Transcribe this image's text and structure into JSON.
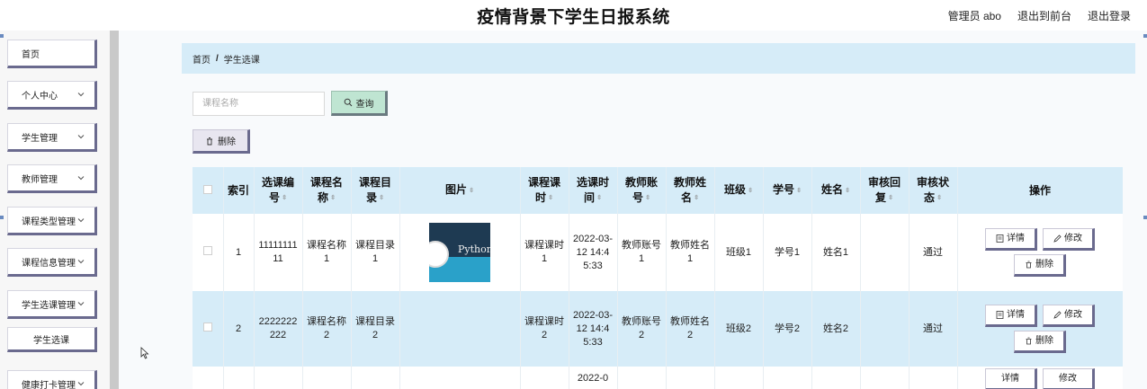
{
  "header": {
    "title": "疫情背景下学生日报系统",
    "admin_label": "管理员 abo",
    "exit_front_label": "退出到前台",
    "logout_label": "退出登录"
  },
  "sidebar": {
    "items": [
      {
        "label": "首页",
        "has_chevron": false
      },
      {
        "label": "个人中心",
        "has_chevron": true
      },
      {
        "label": "学生管理",
        "has_chevron": true
      },
      {
        "label": "教师管理",
        "has_chevron": true
      },
      {
        "label": "课程类型管理",
        "has_chevron": true
      },
      {
        "label": "课程信息管理",
        "has_chevron": true
      },
      {
        "label": "学生选课管理",
        "has_chevron": true
      },
      {
        "label": "健康打卡管理",
        "has_chevron": true
      }
    ],
    "subitem": {
      "label": "学生选课"
    }
  },
  "breadcrumb": {
    "home": "首页",
    "separator": "/",
    "current": "学生选课"
  },
  "search": {
    "placeholder": "课程名称",
    "query_label": "查询"
  },
  "toolbar": {
    "delete_label": "删除"
  },
  "table": {
    "headers": {
      "index": "索引",
      "code": "选课编号",
      "name": "课程名称",
      "catalog": "课程目录",
      "image": "图片",
      "hours": "课程课时",
      "time": "选课时间",
      "teacher_account": "教师账号",
      "teacher_name": "教师姓名",
      "class": "班级",
      "student_no": "学号",
      "student_name": "姓名",
      "review_reply": "审核回复",
      "review_status": "审核状态",
      "actions": "操作"
    },
    "rows": [
      {
        "index": "1",
        "code": "1111111111",
        "name": "课程名称1",
        "catalog": "课程目录1",
        "image_text": "Python",
        "hours": "课程课时1",
        "time": "2022-03-12 14:45:33",
        "teacher_account": "教师账号1",
        "teacher_name": "教师姓名1",
        "class": "班级1",
        "student_no": "学号1",
        "student_name": "姓名1",
        "review_reply": "",
        "review_status": "通过"
      },
      {
        "index": "2",
        "code": "2222222222",
        "name": "课程名称2",
        "catalog": "课程目录2",
        "image_text": "",
        "hours": "课程课时2",
        "time": "2022-03-12 14:45:33",
        "teacher_account": "教师账号2",
        "teacher_name": "教师姓名2",
        "class": "班级2",
        "student_no": "学号2",
        "student_name": "姓名2",
        "review_reply": "",
        "review_status": "通过"
      },
      {
        "index": "",
        "code": "",
        "name": "",
        "catalog": "",
        "image_text": "",
        "hours": "",
        "time": "2022-0",
        "teacher_account": "",
        "teacher_name": "",
        "class": "",
        "student_no": "",
        "student_name": "",
        "review_reply": "",
        "review_status": ""
      }
    ],
    "action_labels": {
      "detail": "详情",
      "edit": "修改",
      "delete": "删除"
    }
  }
}
